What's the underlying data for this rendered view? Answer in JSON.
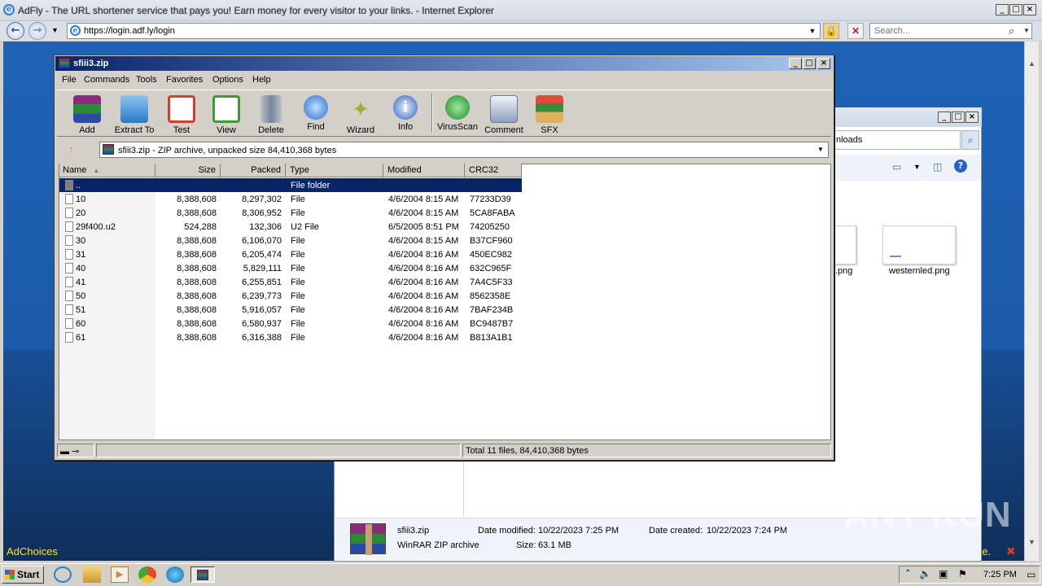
{
  "ie": {
    "title": "AdFly - The URL shortener service that pays you! Earn money for every visitor to your links. - Internet Explorer",
    "url": "https://login.adf.ly/login",
    "search_placeholder": "Search..."
  },
  "page": {
    "adchoices": "AdChoices",
    "ad_tail": "re."
  },
  "explorer": {
    "address_fragment": "nloads",
    "thumbnails": [
      {
        "label": ".png"
      },
      {
        "label": "westernled.png"
      }
    ],
    "details": {
      "file_name": "sfiii3.zip",
      "file_type": "WinRAR ZIP archive",
      "date_modified_label": "Date modified:",
      "date_modified": "10/22/2023 7:25 PM",
      "size_label": "Size:",
      "size": "63.1 MB",
      "date_created_label": "Date created:",
      "date_created": "10/22/2023 7:24 PM"
    }
  },
  "rar": {
    "title": "sfiii3.zip",
    "menu": [
      "File",
      "Commands",
      "Tools",
      "Favorites",
      "Options",
      "Help"
    ],
    "toolbar": [
      {
        "label": "Add",
        "icon": "add-archive-icon",
        "color": "#c8372d"
      },
      {
        "label": "Extract To",
        "icon": "extract-folder-icon",
        "color": "#3a8fd8"
      },
      {
        "label": "Test",
        "icon": "test-clipboard-icon",
        "color": "#d33c2f"
      },
      {
        "label": "View",
        "icon": "view-book-icon",
        "color": "#3a9a3a"
      },
      {
        "label": "Delete",
        "icon": "trash-icon",
        "color": "#8a96a8"
      },
      {
        "label": "Find",
        "icon": "magnifier-icon",
        "color": "#2a6ad0"
      },
      {
        "label": "Wizard",
        "icon": "wand-icon",
        "color": "#9ab038"
      },
      {
        "label": "Info",
        "icon": "info-icon",
        "color": "#2a5fc0"
      },
      {
        "label": "VirusScan",
        "icon": "virus-scan-icon",
        "color": "#3aa83a"
      },
      {
        "label": "Comment",
        "icon": "comment-icon",
        "color": "#8ea0c0"
      },
      {
        "label": "SFX",
        "icon": "sfx-box-icon",
        "color": "#c85a2a"
      }
    ],
    "path": "sfiii3.zip - ZIP archive, unpacked size 84,410,368 bytes",
    "columns": [
      "Name",
      "Size",
      "Packed",
      "Type",
      "Modified",
      "CRC32"
    ],
    "rows": [
      {
        "name": "..",
        "size": "",
        "packed": "",
        "type": "File folder",
        "modified": "",
        "crc": ""
      },
      {
        "name": "10",
        "size": "8,388,608",
        "packed": "8,297,302",
        "type": "File",
        "modified": "4/6/2004 8:15 AM",
        "crc": "77233D39"
      },
      {
        "name": "20",
        "size": "8,388,608",
        "packed": "8,306,952",
        "type": "File",
        "modified": "4/6/2004 8:15 AM",
        "crc": "5CA8FABA"
      },
      {
        "name": "29f400.u2",
        "size": "524,288",
        "packed": "132,306",
        "type": "U2 File",
        "modified": "6/5/2005 8:51 PM",
        "crc": "74205250"
      },
      {
        "name": "30",
        "size": "8,388,608",
        "packed": "6,106,070",
        "type": "File",
        "modified": "4/6/2004 8:15 AM",
        "crc": "B37CF960"
      },
      {
        "name": "31",
        "size": "8,388,608",
        "packed": "6,205,474",
        "type": "File",
        "modified": "4/6/2004 8:16 AM",
        "crc": "450EC982"
      },
      {
        "name": "40",
        "size": "8,388,608",
        "packed": "5,829,111",
        "type": "File",
        "modified": "4/6/2004 8:16 AM",
        "crc": "632C965F"
      },
      {
        "name": "41",
        "size": "8,388,608",
        "packed": "6,255,851",
        "type": "File",
        "modified": "4/6/2004 8:16 AM",
        "crc": "7A4C5F33"
      },
      {
        "name": "50",
        "size": "8,388,608",
        "packed": "6,239,773",
        "type": "File",
        "modified": "4/6/2004 8:16 AM",
        "crc": "8562358E"
      },
      {
        "name": "51",
        "size": "8,388,608",
        "packed": "5,916,057",
        "type": "File",
        "modified": "4/6/2004 8:16 AM",
        "crc": "7BAF234B"
      },
      {
        "name": "60",
        "size": "8,388,608",
        "packed": "6,580,937",
        "type": "File",
        "modified": "4/6/2004 8:16 AM",
        "crc": "BC9487B7"
      },
      {
        "name": "61",
        "size": "8,388,608",
        "packed": "6,316,388",
        "type": "File",
        "modified": "4/6/2004 8:16 AM",
        "crc": "B813A1B1"
      }
    ],
    "status_total": "Total 11 files, 84,410,368 bytes"
  },
  "taskbar": {
    "start_label": "Start",
    "clock": "7:25 PM"
  },
  "watermark": "ANY RUN"
}
